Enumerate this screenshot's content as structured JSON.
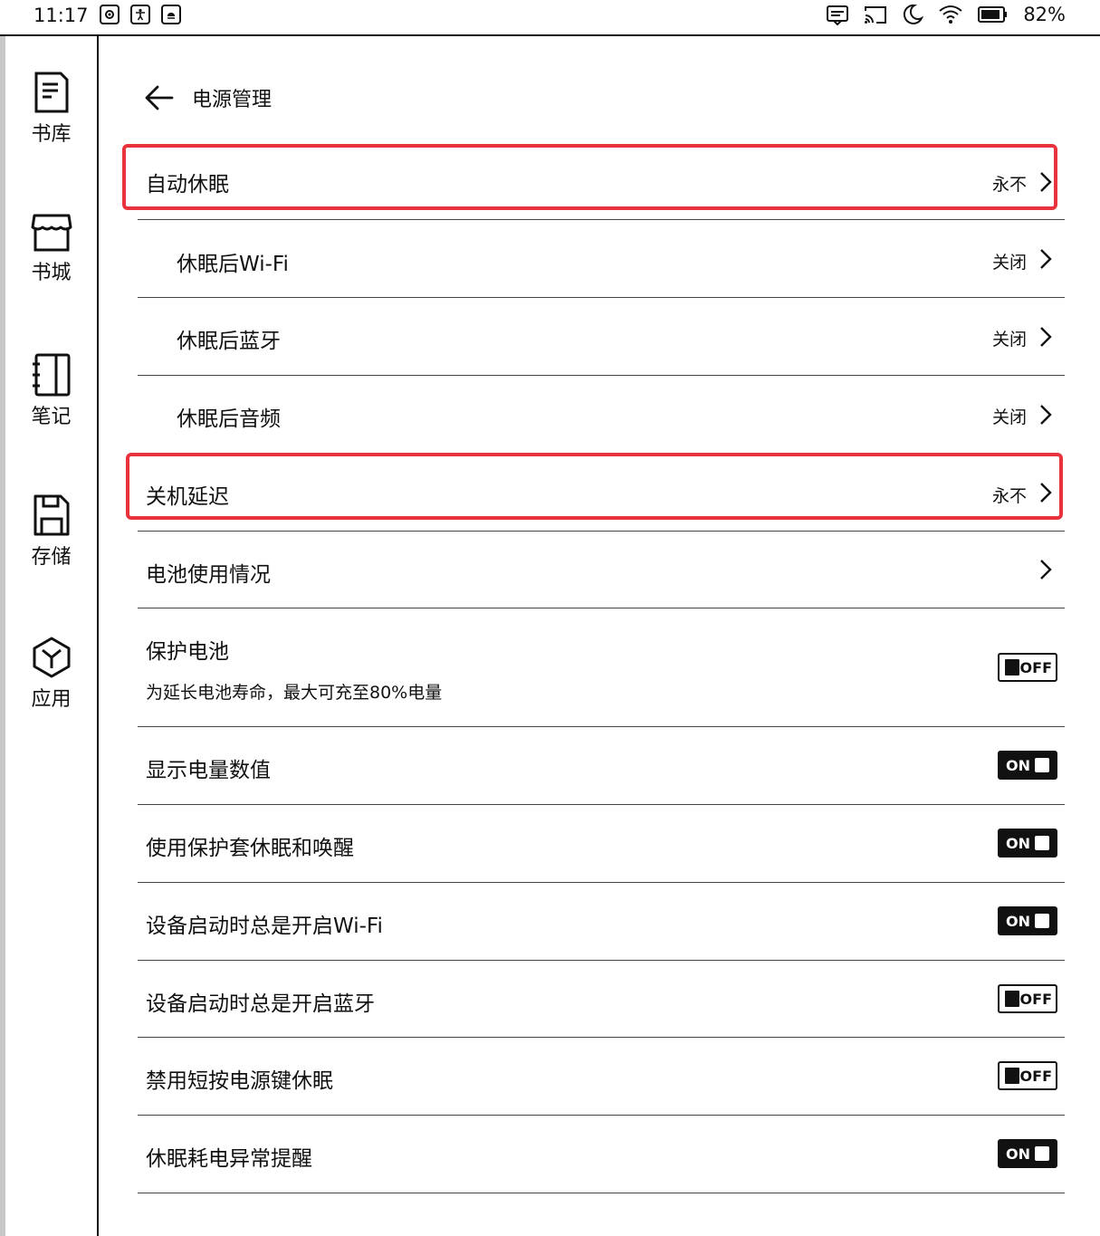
{
  "status_bar": {
    "time": "11:17",
    "battery": "82%"
  },
  "sidebar": {
    "items": [
      {
        "label": "书库",
        "icon": "library-icon"
      },
      {
        "label": "书城",
        "icon": "store-icon"
      },
      {
        "label": "笔记",
        "icon": "notebook-icon"
      },
      {
        "label": "存储",
        "icon": "storage-icon"
      },
      {
        "label": "应用",
        "icon": "apps-icon"
      }
    ]
  },
  "header": {
    "title": "电源管理"
  },
  "settings": {
    "auto_sleep": {
      "title": "自动休眠",
      "value": "永不"
    },
    "wifi_after_sleep": {
      "title": "休眠后Wi-Fi",
      "value": "关闭"
    },
    "bt_after_sleep": {
      "title": "休眠后蓝牙",
      "value": "关闭"
    },
    "audio_after_sleep": {
      "title": "休眠后音频",
      "value": "关闭"
    },
    "shutdown_delay": {
      "title": "关机延迟",
      "value": "永不"
    },
    "battery_usage": {
      "title": "电池使用情况"
    },
    "protect_battery": {
      "title": "保护电池",
      "subtitle": "为延长电池寿命，最大可充至80%电量",
      "state": "OFF"
    },
    "show_battery_value": {
      "title": "显示电量数值",
      "state": "ON"
    },
    "cover_sleep_wake": {
      "title": "使用保护套休眠和唤醒",
      "state": "ON"
    },
    "boot_wifi": {
      "title": "设备启动时总是开启Wi-Fi",
      "state": "ON"
    },
    "boot_bt": {
      "title": "设备启动时总是开启蓝牙",
      "state": "OFF"
    },
    "disable_short_press": {
      "title": "禁用短按电源键休眠",
      "state": "OFF"
    },
    "sleep_drain_alert": {
      "title": "休眠耗电异常提醒",
      "state": "ON"
    }
  },
  "colors": {
    "highlight": "#e8323c",
    "text": "#111111"
  }
}
